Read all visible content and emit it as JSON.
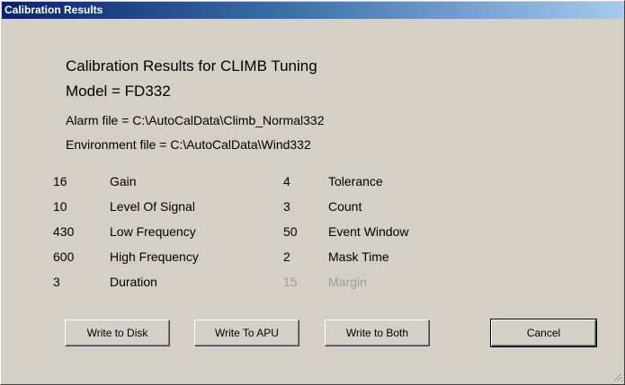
{
  "window": {
    "title": "Calibration Results"
  },
  "header": {
    "title": "Calibration Results for CLIMB Tuning",
    "model": "Model = FD332"
  },
  "files": {
    "alarm": "Alarm file = C:\\AutoCalData\\Climb_Normal332",
    "environment": "Environment file = C:\\AutoCalData\\Wind332"
  },
  "params_left": [
    {
      "value": "16",
      "label": "Gain"
    },
    {
      "value": "10",
      "label": "Level Of Signal"
    },
    {
      "value": "430",
      "label": "Low Frequency"
    },
    {
      "value": "600",
      "label": "High Frequency"
    },
    {
      "value": "3",
      "label": "Duration"
    }
  ],
  "params_right": [
    {
      "value": "4",
      "label": "Tolerance"
    },
    {
      "value": "3",
      "label": "Count"
    },
    {
      "value": "50",
      "label": "Event Window"
    },
    {
      "value": "2",
      "label": "Mask Time"
    },
    {
      "value": "15",
      "label": "Margin",
      "disabled": true
    }
  ],
  "buttons": {
    "write_disk": "Write to Disk",
    "write_apu": "Write To APU",
    "write_both": "Write to Both",
    "cancel": "Cancel"
  },
  "colors": {
    "dialog_bg": "#d4d0c8",
    "titlebar_start": "#0a246a",
    "titlebar_end": "#a6caf0",
    "disabled_text": "#9c9c9c"
  }
}
